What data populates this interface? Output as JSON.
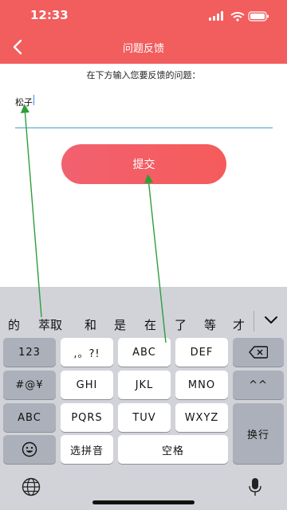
{
  "status": {
    "time": "12:33"
  },
  "header": {
    "title": "问题反馈",
    "back_icon": "chevron-left-icon"
  },
  "form": {
    "prompt": "在下方输入您要反馈的问题：",
    "input_value": "松子",
    "submit_label": "提交"
  },
  "keyboard": {
    "candidates": [
      "的",
      "萃取",
      "和",
      "是",
      "在",
      "了",
      "等",
      "才"
    ],
    "row1": [
      "123",
      ",。?!",
      "ABC",
      "DEF"
    ],
    "row2": [
      "#@¥",
      "GHI",
      "JKL",
      "MNO",
      "^^"
    ],
    "row3": [
      "ABC",
      "PQRS",
      "TUV",
      "WXYZ"
    ],
    "row4": [
      "选拼音",
      "空格"
    ],
    "return_label": "换行",
    "emoji_icon": "emoji-icon",
    "delete_icon": "backspace-icon",
    "globe_icon": "globe-icon",
    "mic_icon": "microphone-icon"
  },
  "colors": {
    "brand": "#f25d5d",
    "annotation": "#2e9e3a",
    "underline": "#4aa3c2"
  }
}
